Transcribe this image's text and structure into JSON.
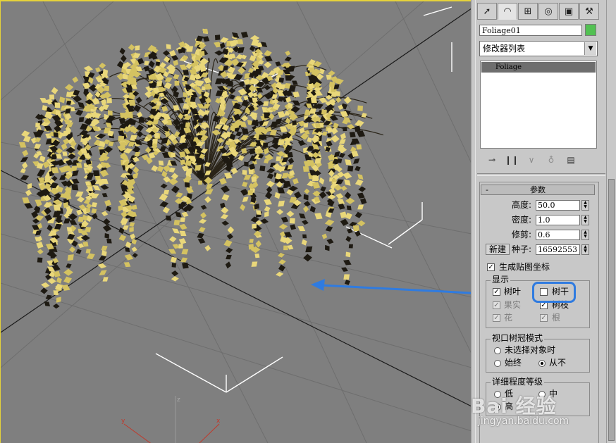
{
  "viewport": {
    "axis_x": "x",
    "axis_y": "y",
    "axis_z": "z"
  },
  "tabs": [
    "cursor-icon",
    "arc-icon",
    "hierarchy-icon",
    "motion-icon",
    "display-icon",
    "hammer-icon"
  ],
  "object": {
    "name": "Foliage01",
    "color": "#52c152"
  },
  "modifier_list": {
    "label": "修改器列表"
  },
  "stack": {
    "items": [
      "Foliage"
    ]
  },
  "params": {
    "title": "参数",
    "height_label": "高度:",
    "height_value": "50.0",
    "density_label": "密度:",
    "density_value": "1.0",
    "prune_label": "修剪:",
    "prune_value": "0.6",
    "new_button": "新建",
    "seed_label": "种子:",
    "seed_value": "16592553",
    "gen_map_coords": "生成贴图坐标",
    "display_title": "显示",
    "leaves": "树叶",
    "trunk": "树干",
    "fruit": "果实",
    "branches": "树枝",
    "flowers": "花",
    "roots": "根",
    "canopy_title": "视口树冠模式",
    "canopy_unselected": "未选择对象时",
    "canopy_always": "始终",
    "canopy_never": "从不",
    "lod_title": "详细程度等级",
    "lod_low": "低",
    "lod_mid": "中",
    "lod_high": "高"
  },
  "watermark": {
    "text": "Bai 经验",
    "url": "jingyan.baidu.com"
  }
}
